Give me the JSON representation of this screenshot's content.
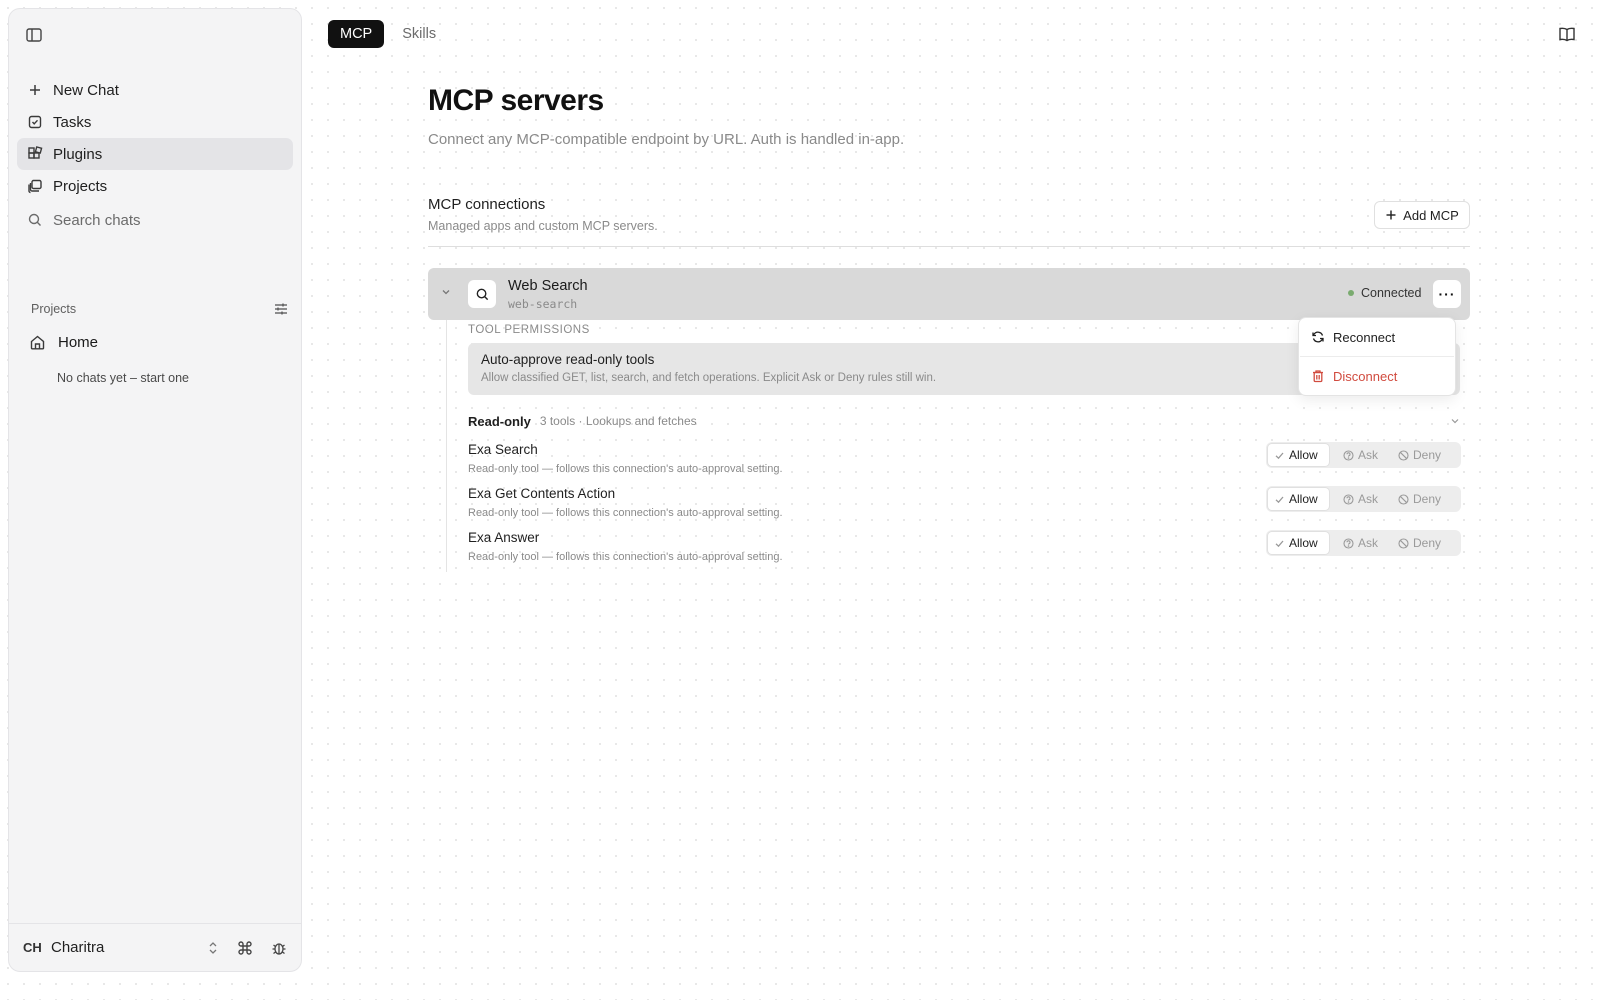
{
  "sidebar": {
    "nav": [
      {
        "label": "New Chat",
        "icon": "plus-icon"
      },
      {
        "label": "Tasks",
        "icon": "task-checkbox-icon"
      },
      {
        "label": "Plugins",
        "icon": "plugins-grid-icon",
        "active": true
      },
      {
        "label": "Projects",
        "icon": "projects-stack-icon"
      }
    ],
    "search_label": "Search chats",
    "projects_label": "Projects",
    "home_label": "Home",
    "no_chats": "No chats yet – start one",
    "user": {
      "initials": "CH",
      "name": "Charitra"
    }
  },
  "tabs": [
    {
      "label": "MCP",
      "active": true
    },
    {
      "label": "Skills",
      "active": false
    }
  ],
  "page": {
    "title": "MCP servers",
    "subtitle": "Connect any MCP-compatible endpoint by URL. Auth is handled in-app."
  },
  "connections": {
    "title": "MCP connections",
    "subtitle": "Managed apps and custom MCP servers.",
    "add_label": "Add MCP"
  },
  "server": {
    "name": "Web Search",
    "slug": "web-search",
    "status": "Connected",
    "status_color": "#7aab6f",
    "more_label": "···"
  },
  "permissions": {
    "label": "TOOL PERMISSIONS",
    "auto_title": "Auto-approve read-only tools",
    "auto_desc": "Allow classified GET, list, search, and fetch operations. Explicit Ask or Deny rules still win."
  },
  "group": {
    "name": "Read-only",
    "meta": "3 tools · Lookups and fetches"
  },
  "tools": [
    {
      "name": "Exa Search",
      "desc": "Read-only tool — follows this connection's auto-approval setting.",
      "selected": "Allow"
    },
    {
      "name": "Exa Get Contents Action",
      "desc": "Read-only tool — follows this connection's auto-approval setting.",
      "selected": "Allow"
    },
    {
      "name": "Exa Answer",
      "desc": "Read-only tool — follows this connection's auto-approval setting.",
      "selected": "Allow"
    }
  ],
  "options": {
    "allow": "Allow",
    "ask": "Ask",
    "deny": "Deny"
  },
  "menu": {
    "reconnect": "Reconnect",
    "disconnect": "Disconnect",
    "disconnect_color": "#d14b3f"
  }
}
